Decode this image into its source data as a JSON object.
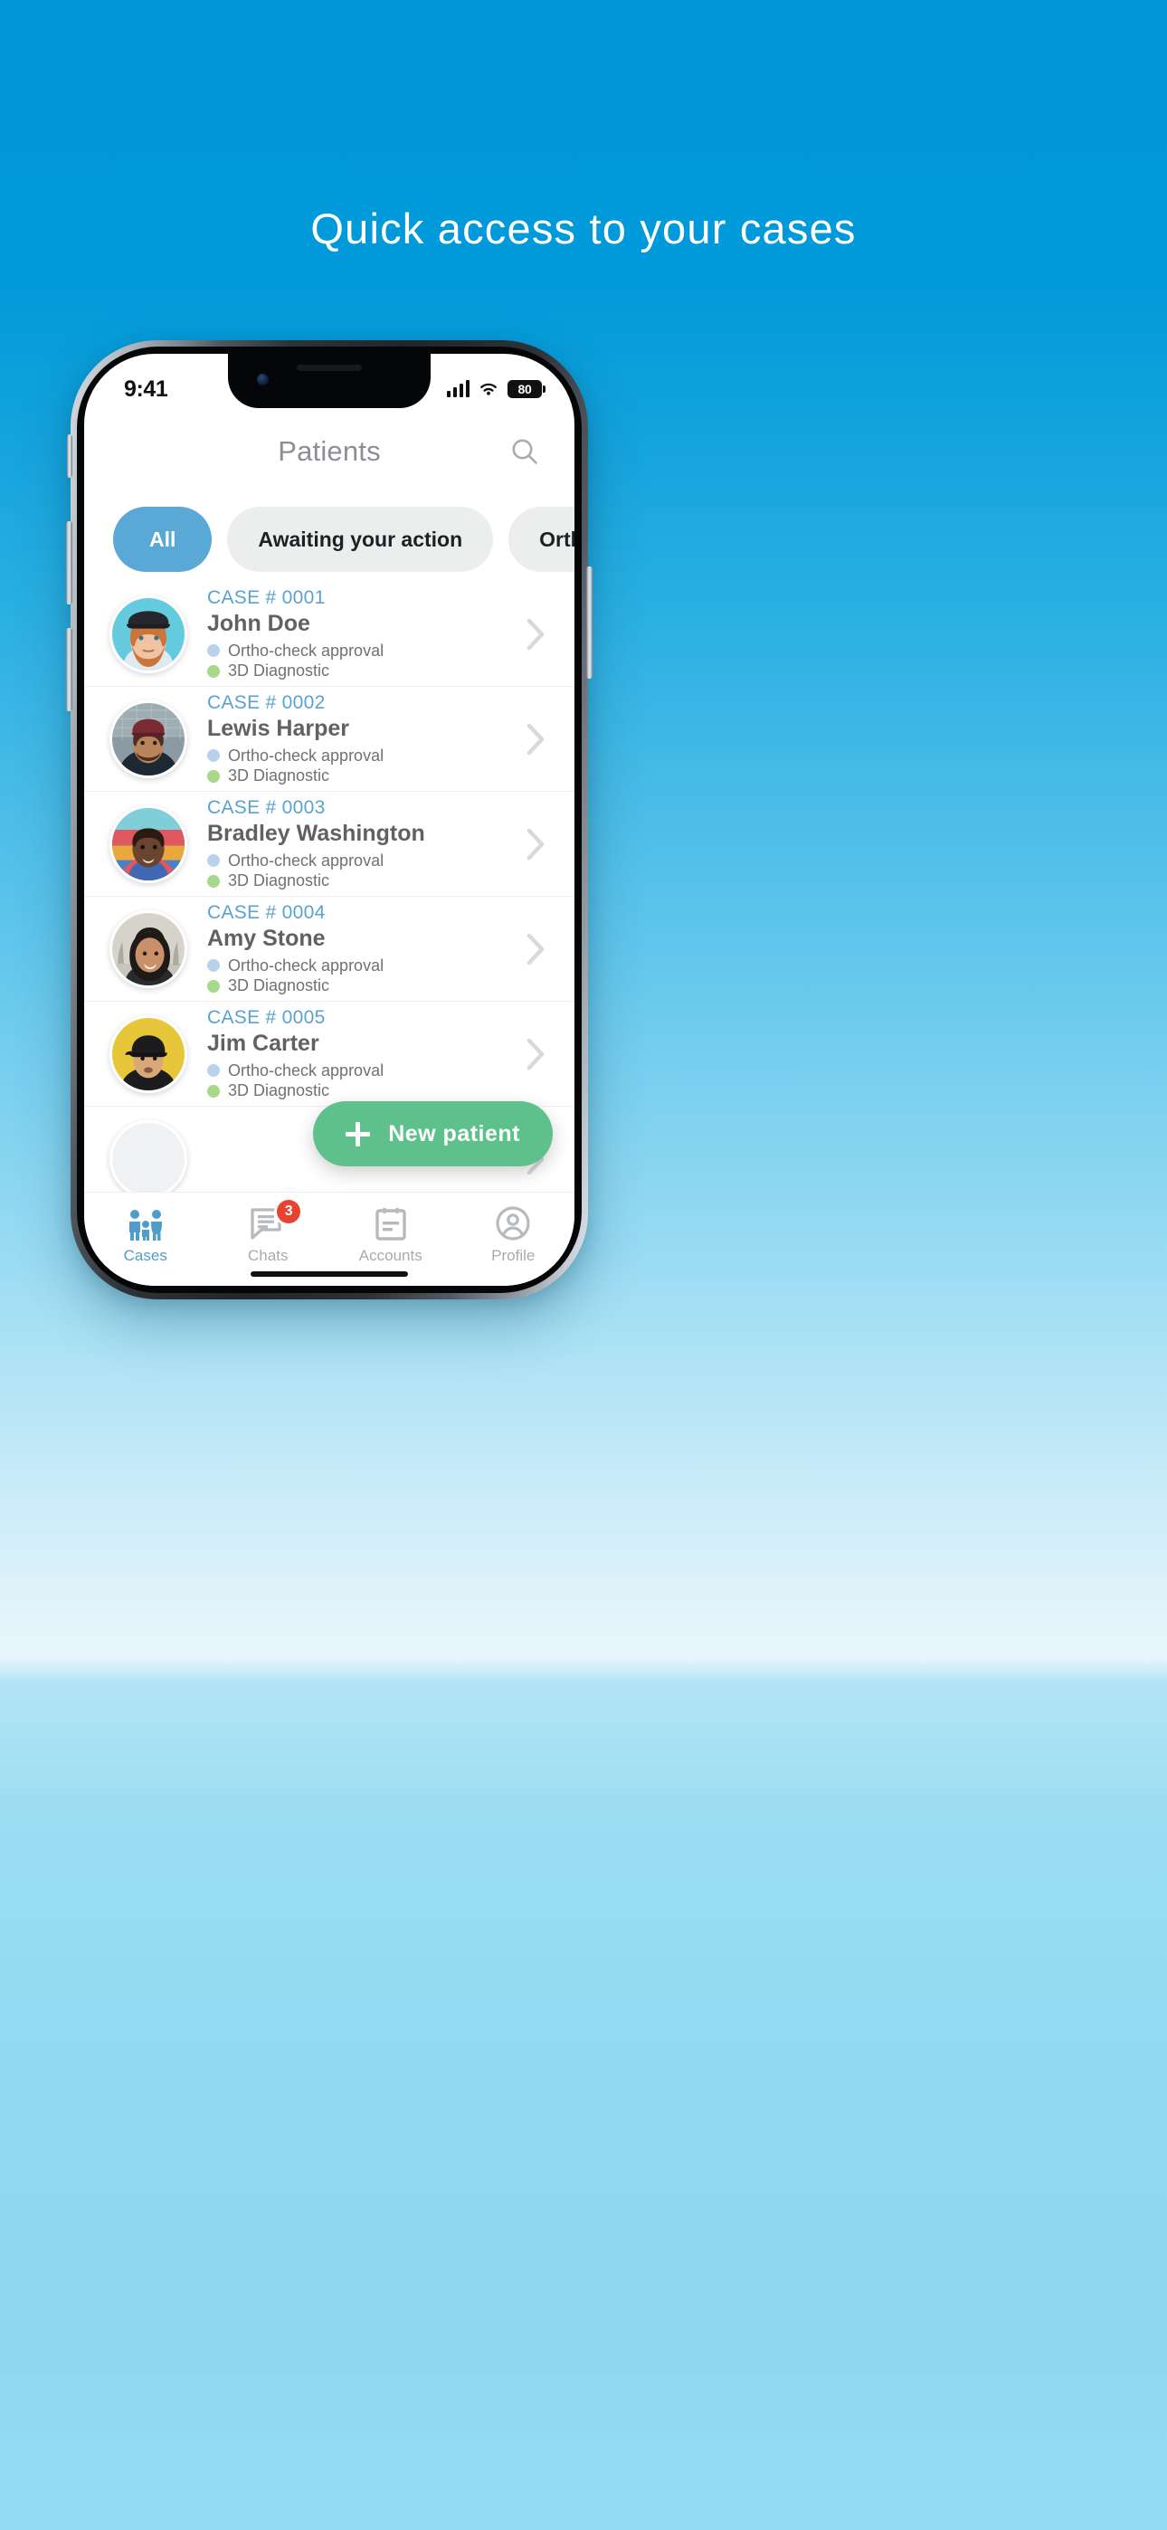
{
  "headline": "Quick access to your cases",
  "statusbar": {
    "time": "9:41",
    "battery_level": "80",
    "signal_icon": "cellular-signal-icon",
    "wifi_icon": "wifi-icon",
    "battery_icon": "battery-icon"
  },
  "header": {
    "title": "Patients",
    "search_icon": "search-icon"
  },
  "filters": [
    {
      "label": "All",
      "active": true
    },
    {
      "label": "Awaiting your action",
      "active": false
    },
    {
      "label": "Ortho-check approval",
      "active": false
    }
  ],
  "cases": [
    {
      "case_no": "CASE # 0001",
      "name": "John Doe",
      "tags": [
        {
          "text": "Ortho-check approval",
          "color": "#b9d2ec"
        },
        {
          "text": "3D Diagnostic",
          "color": "#a7d98a"
        }
      ],
      "avatar_bg": "#63cbdd",
      "avatar_alt": "patient-photo"
    },
    {
      "case_no": "CASE # 0002",
      "name": "Lewis Harper",
      "tags": [
        {
          "text": "Ortho-check approval",
          "color": "#b9d2ec"
        },
        {
          "text": "3D Diagnostic",
          "color": "#a7d98a"
        }
      ],
      "avatar_bg": "#5a6b74",
      "avatar_alt": "patient-photo"
    },
    {
      "case_no": "CASE # 0003",
      "name": "Bradley Washington",
      "tags": [
        {
          "text": "Ortho-check approval",
          "color": "#b9d2ec"
        },
        {
          "text": "3D Diagnostic",
          "color": "#a7d98a"
        }
      ],
      "avatar_bg": "#d96fa0",
      "avatar_alt": "patient-photo"
    },
    {
      "case_no": "CASE # 0004",
      "name": "Amy Stone",
      "tags": [
        {
          "text": "Ortho-check approval",
          "color": "#b9d2ec"
        },
        {
          "text": "3D Diagnostic",
          "color": "#a7d98a"
        }
      ],
      "avatar_bg": "#cfcdc6",
      "avatar_alt": "patient-photo"
    },
    {
      "case_no": "CASE # 0005",
      "name": "Jim Carter",
      "tags": [
        {
          "text": "Ortho-check approval",
          "color": "#b9d2ec"
        },
        {
          "text": "3D Diagnostic",
          "color": "#a7d98a"
        }
      ],
      "avatar_bg": "#e8c639",
      "avatar_alt": "patient-photo"
    }
  ],
  "fab": {
    "label": "New patient",
    "icon": "plus-icon",
    "color": "#5ec18b"
  },
  "tabbar": [
    {
      "label": "Cases",
      "icon": "family-icon",
      "active": true,
      "badge": ""
    },
    {
      "label": "Chats",
      "icon": "chat-bubble-icon",
      "active": false,
      "badge": "3"
    },
    {
      "label": "Accounts",
      "icon": "document-icon",
      "active": false,
      "badge": ""
    },
    {
      "label": "Profile",
      "icon": "person-circle-icon",
      "active": false,
      "badge": ""
    }
  ],
  "colors": {
    "accent_blue": "#5aa8d6",
    "case_blue": "#5aa2cf",
    "green": "#5ec18b",
    "badge_red": "#e8432e",
    "backdrop_top": "#0098D8",
    "backdrop_bottom": "#93DBF2"
  }
}
